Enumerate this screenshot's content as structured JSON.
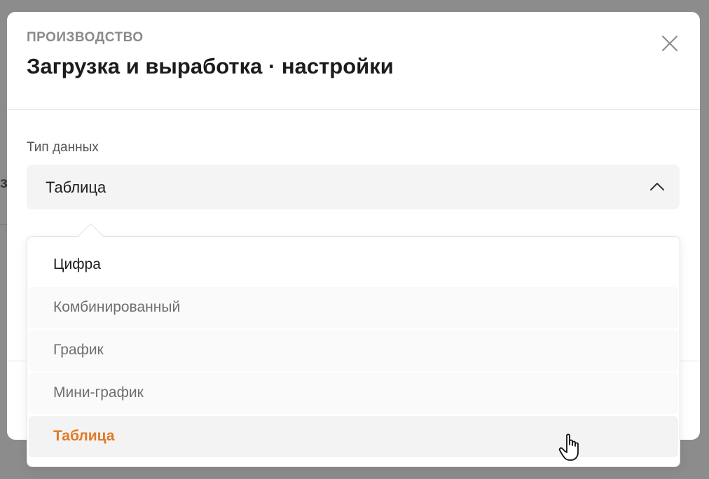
{
  "modal": {
    "eyebrow": "ПРОИЗВОДСТВО",
    "title": "Загрузка и выработка · настройки"
  },
  "field": {
    "label": "Тип данных",
    "selected_value": "Таблица"
  },
  "dropdown": {
    "options": [
      {
        "label": "Цифра"
      },
      {
        "label": "Комбинированный"
      },
      {
        "label": "График"
      },
      {
        "label": "Мини-график"
      },
      {
        "label": "Таблица",
        "selected": true
      }
    ]
  },
  "icons": {
    "close": "close-icon",
    "chevron": "chevron-up-icon",
    "cursor": "hand-pointer-icon"
  },
  "colors": {
    "accent": "#e07a26",
    "overlay": "#8c8c8c",
    "select_bg": "#f4f4f4"
  }
}
